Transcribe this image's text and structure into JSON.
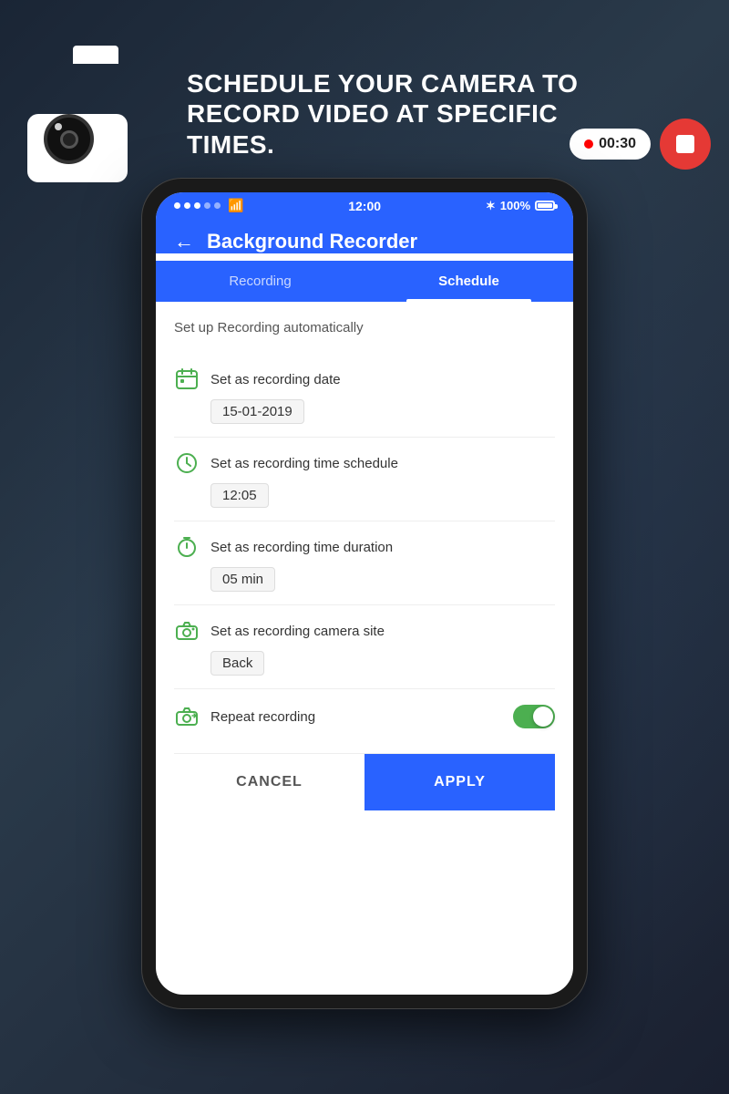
{
  "background": {
    "color": "#1a2535"
  },
  "header": {
    "title_line1": "SCHEDULE YOUR CAMERA TO",
    "title_line2": "RECORD VIDEO AT SPECIFIC",
    "title_line3": "TIMES."
  },
  "record_control": {
    "timer": "00:30",
    "dot_color": "red"
  },
  "phone": {
    "status_bar": {
      "time": "12:00",
      "battery_percent": "100%"
    },
    "app_bar": {
      "title": "Background Recorder"
    },
    "tabs": [
      {
        "label": "Recording",
        "active": false
      },
      {
        "label": "Schedule",
        "active": true
      }
    ],
    "content": {
      "section_title": "Set up Recording automatically",
      "settings": [
        {
          "id": "recording-date",
          "label": "Set as recording date",
          "value": "15-01-2019",
          "icon": "calendar-icon"
        },
        {
          "id": "time-schedule",
          "label": "Set as recording time schedule",
          "value": "12:05",
          "icon": "clock-icon"
        },
        {
          "id": "time-duration",
          "label": "Set as recording time duration",
          "value": "05 min",
          "icon": "timer-icon"
        },
        {
          "id": "camera-site",
          "label": "Set as recording camera site",
          "value": "Back",
          "icon": "camera-site-icon"
        }
      ],
      "toggle_row": {
        "label": "Repeat recording",
        "enabled": true,
        "icon": "repeat-icon"
      },
      "buttons": {
        "cancel": "CANCEL",
        "apply": "APPLY"
      }
    }
  }
}
